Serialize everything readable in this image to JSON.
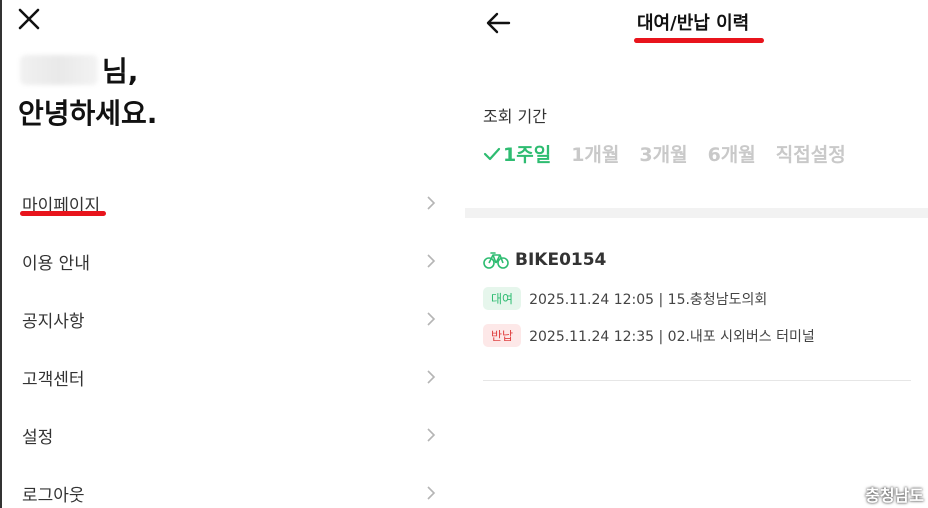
{
  "drawer": {
    "greeting_suffix": "님,",
    "greeting_line2": "안녕하세요.",
    "menu_items": [
      {
        "label": "마이페이지"
      },
      {
        "label": "이용 안내"
      },
      {
        "label": "공지사항"
      },
      {
        "label": "고객센터"
      },
      {
        "label": "설정"
      },
      {
        "label": "로그아웃"
      }
    ]
  },
  "history": {
    "title": "대여/반납 이력",
    "period_label": "조회 기간",
    "period_tabs": [
      {
        "label": "1주일",
        "active": true
      },
      {
        "label": "1개월",
        "active": false
      },
      {
        "label": "3개월",
        "active": false
      },
      {
        "label": "6개월",
        "active": false
      },
      {
        "label": "직접설정",
        "active": false
      }
    ],
    "record": {
      "bike_id": "BIKE0154",
      "rent": {
        "badge": "대여",
        "text": "2025.11.24 12:05 | 15.충청남도의회"
      },
      "return": {
        "badge": "반납",
        "text": "2025.11.24 12:35 | 02.내포 시외버스 터미널"
      }
    }
  },
  "watermark": "충청남도",
  "colors": {
    "accent": "#2ebc71",
    "annotation": "#e8141c",
    "return_badge": "#e04444"
  },
  "icons": {
    "close": "close-icon",
    "back": "arrow-left-icon",
    "chevron": "chevron-right-icon",
    "bike": "bicycle-icon",
    "check": "check-icon"
  }
}
